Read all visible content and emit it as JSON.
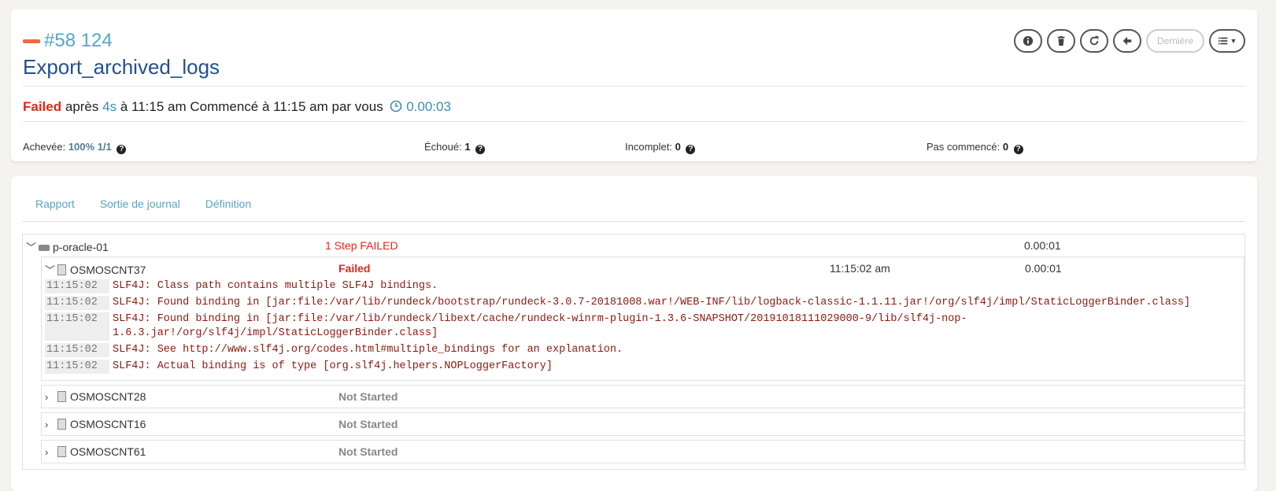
{
  "execution": {
    "id": "#58 124",
    "job_name": "Export_archived_logs",
    "status": "Failed",
    "after_label": "après",
    "duration_short": "4s",
    "finished_text": "à 11:15 am Commencé à 11:15 am par vous",
    "elapsed": "0.00:03"
  },
  "actions": {
    "info_icon": "info-icon",
    "delete_icon": "trash-icon",
    "rerun_icon": "refresh-icon",
    "back_icon": "arrow-left-icon",
    "last_label": "Dernière",
    "menu_icon": "list-icon"
  },
  "stats": {
    "done_label": "Achevée:",
    "done_value": "100% 1/1",
    "failed_label": "Échoué:",
    "failed_value": "1",
    "incomplete_label": "Incomplet:",
    "incomplete_value": "0",
    "not_started_label": "Pas commencé:",
    "not_started_value": "0"
  },
  "tabs": [
    {
      "label": "Rapport"
    },
    {
      "label": "Sortie de journal"
    },
    {
      "label": "Définition"
    }
  ],
  "node": {
    "name": "p-oracle-01",
    "status": "1 Step FAILED",
    "duration": "0.00:01"
  },
  "steps": [
    {
      "name": "OSMOSCNT37",
      "status": "Failed",
      "time": "11:15:02 am",
      "duration": "0.00:01",
      "logs": [
        {
          "ts": "11:15:02",
          "msg": "SLF4J: Class path contains multiple SLF4J bindings."
        },
        {
          "ts": "11:15:02",
          "msg": "SLF4J: Found binding in [jar:file:/var/lib/rundeck/bootstrap/rundeck-3.0.7-20181008.war!/WEB-INF/lib/logback-classic-1.1.11.jar!/org/slf4j/impl/StaticLoggerBinder.class]"
        },
        {
          "ts": "11:15:02",
          "msg": "SLF4J: Found binding in [jar:file:/var/lib/rundeck/libext/cache/rundeck-winrm-plugin-1.3.6-SNAPSHOT/20191018111029000-9/lib/slf4j-nop-\n1.6.3.jar!/org/slf4j/impl/StaticLoggerBinder.class]"
        },
        {
          "ts": "11:15:02",
          "msg": "SLF4J: See http://www.slf4j.org/codes.html#multiple_bindings for an explanation."
        },
        {
          "ts": "11:15:02",
          "msg": "SLF4J: Actual binding is of type [org.slf4j.helpers.NOPLoggerFactory]"
        }
      ]
    },
    {
      "name": "OSMOSCNT28",
      "status": "Not Started"
    },
    {
      "name": "OSMOSCNT16",
      "status": "Not Started"
    },
    {
      "name": "OSMOSCNT61",
      "status": "Not Started"
    }
  ]
}
